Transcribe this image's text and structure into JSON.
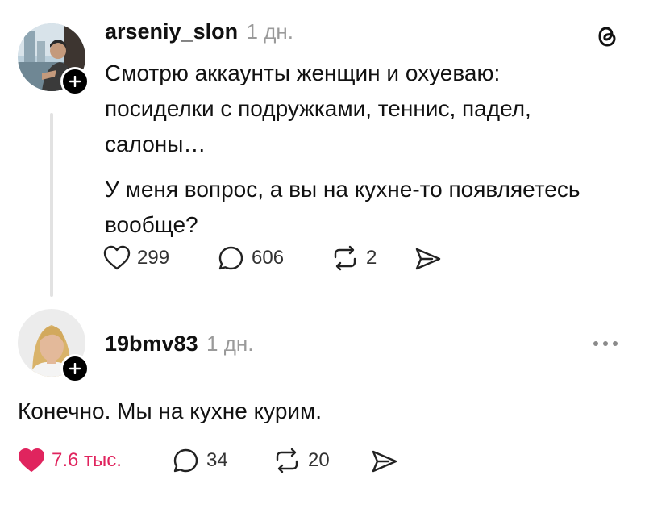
{
  "post": {
    "username": "arseniy_slon",
    "time": "1 дн.",
    "paragraphs": [
      "Смотрю аккаунты женщин и охуеваю:",
      "посиделки с подружками, теннис, падел,",
      "салоны…",
      "У меня вопрос, а вы на кухне-то появляетесь",
      "вообще?"
    ],
    "actions": {
      "likes": "299",
      "comments": "606",
      "reposts": "2"
    },
    "app_icon": "threads-logo-icon"
  },
  "reply": {
    "username": "19bmv83",
    "time": "1 дн.",
    "text": "Конечно. Мы на кухне курим.",
    "actions": {
      "likes": "7.6 тыс.",
      "comments": "34",
      "reposts": "20",
      "liked": true
    },
    "menu_icon": "more-icon"
  },
  "colors": {
    "like_active": "#e0245e",
    "muted": "#9a9a9a",
    "thread_line": "#e2e2e2"
  }
}
